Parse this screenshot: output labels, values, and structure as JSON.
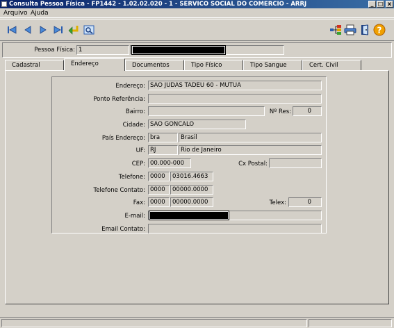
{
  "window": {
    "title": "Consulta Pessoa Física - FP1442 - 1.02.02.020 - 1 - SERVICO SOCIAL DO COMERCIO - ARRJ",
    "min_label": "_",
    "max_label": "□",
    "close_label": "x"
  },
  "menu": [
    "Arquivo",
    "Ajuda"
  ],
  "toolbar": {
    "left_icons": [
      "first-record-icon",
      "previous-record-icon",
      "next-record-icon",
      "last-record-icon",
      "return-arrow-icon",
      "view-image-icon"
    ],
    "right_icons": [
      "tree-structure-icon",
      "printer-icon",
      "exit-door-icon",
      "help-icon"
    ]
  },
  "pessoa_fisica": {
    "label": "Pessoa Física:",
    "code": "1"
  },
  "tabs": [
    "Cadastral",
    "Endereço",
    "Documentos",
    "Tipo Físico",
    "Tipo Sangue",
    "Cert. Civil"
  ],
  "active_tab": "Endereço",
  "form": {
    "endereco_label": "Endereço:",
    "endereco": "SAO JUDAS TADEU 60 - MUTUA",
    "ponto_ref_label": "Ponto Referência:",
    "ponto_ref": "",
    "bairro_label": "Bairro:",
    "bairro": "",
    "nres_label": "Nº Res:",
    "nres": "0",
    "cidade_label": "Cidade:",
    "cidade": "SAO GONCALO",
    "pais_label": "País Endereço:",
    "pais_code": "bra",
    "pais_name": "Brasil",
    "uf_label": "UF:",
    "uf_code": "RJ",
    "uf_name": "Rio de Janeiro",
    "cep_label": "CEP:",
    "cep": "00.000-000",
    "cxpostal_label": "Cx Postal:",
    "cxpostal": "",
    "telefone_label": "Telefone:",
    "telefone_ddd": "0000",
    "telefone": "03016.4663",
    "tel_contato_label": "Telefone Contato:",
    "tel_contato_ddd": "0000",
    "tel_contato": "00000.0000",
    "fax_label": "Fax:",
    "fax_ddd": "0000",
    "fax": "00000.0000",
    "telex_label": "Telex:",
    "telex": "0",
    "email_label": "E-mail:",
    "email_contato_label": "Email Contato:",
    "email_contato": ""
  }
}
